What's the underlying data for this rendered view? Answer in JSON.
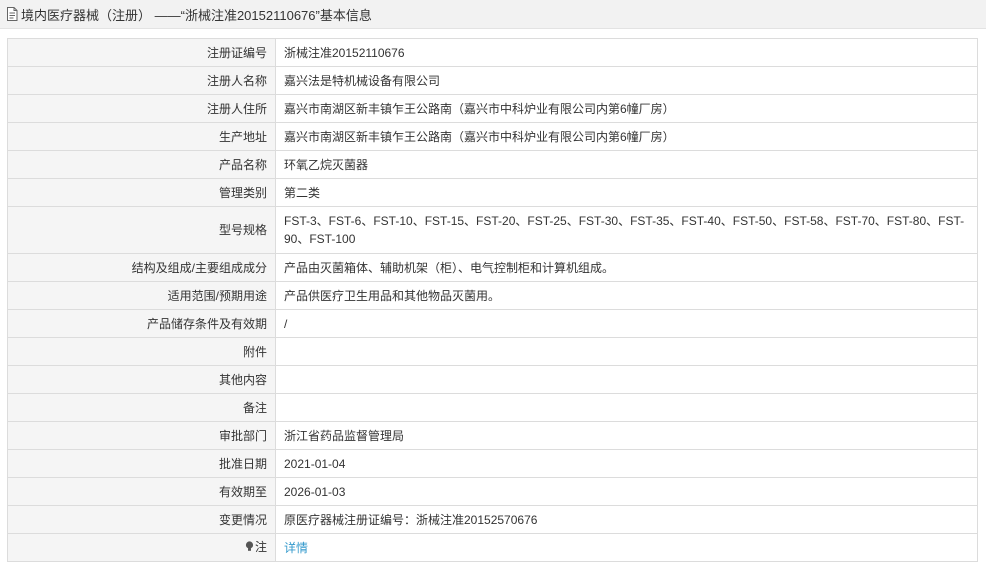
{
  "header": {
    "title": "境内医疗器械（注册） ——“浙械注准20152110676”基本信息",
    "icon": "document-icon"
  },
  "rows": [
    {
      "label": "注册证编号",
      "value": "浙械注准20152110676"
    },
    {
      "label": "注册人名称",
      "value": "嘉兴法是特机械设备有限公司"
    },
    {
      "label": "注册人住所",
      "value": "嘉兴市南湖区新丰镇乍王公路南（嘉兴市中科炉业有限公司内第6幢厂房）"
    },
    {
      "label": "生产地址",
      "value": "嘉兴市南湖区新丰镇乍王公路南（嘉兴市中科炉业有限公司内第6幢厂房）"
    },
    {
      "label": "产品名称",
      "value": "环氧乙烷灭菌器"
    },
    {
      "label": "管理类别",
      "value": "第二类"
    },
    {
      "label": "型号规格",
      "value": "FST-3、FST-6、FST-10、FST-15、FST-20、FST-25、FST-30、FST-35、FST-40、FST-50、FST-58、FST-70、FST-80、FST-90、FST-100"
    },
    {
      "label": "结构及组成/主要组成成分",
      "value": "产品由灭菌箱体、辅助机架（柜）、电气控制柜和计算机组成。"
    },
    {
      "label": "适用范围/预期用途",
      "value": "产品供医疗卫生用品和其他物品灭菌用。"
    },
    {
      "label": "产品储存条件及有效期",
      "value": "/"
    },
    {
      "label": "附件",
      "value": ""
    },
    {
      "label": "其他内容",
      "value": ""
    },
    {
      "label": "备注",
      "value": ""
    },
    {
      "label": "审批部门",
      "value": "浙江省药品监督管理局"
    },
    {
      "label": "批准日期",
      "value": "2021-01-04"
    },
    {
      "label": "有效期至",
      "value": "2026-01-03"
    },
    {
      "label": "变更情况",
      "value": "原医疗器械注册证编号：浙械注准20152570676"
    }
  ],
  "note": {
    "label": "注",
    "icon": "lightbulb-icon",
    "link": "详情"
  }
}
